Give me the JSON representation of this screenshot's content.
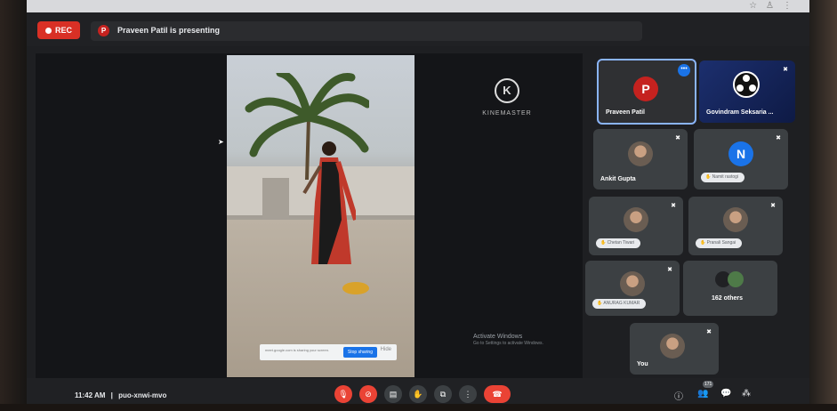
{
  "browser": {
    "icons": [
      "star-icon",
      "person-icon",
      "kebab-icon"
    ]
  },
  "header": {
    "rec_label": "REC",
    "presenter_initial": "P",
    "presenting_text": "Praveen Patil is presenting"
  },
  "stage": {
    "share_message": "meet.google.com is sharing your screen.",
    "stop_label": "Stop sharing",
    "hide_label": "Hide",
    "kinemaster_label": "KINEMASTER",
    "kinemaster_letter": "K",
    "activate_title": "Activate Windows",
    "activate_sub": "Go to Settings to activate Windows."
  },
  "participants": [
    {
      "name": "Praveen Patil",
      "initial": "P",
      "color": "#c5221f"
    },
    {
      "name": "Govindram Seksaria ..."
    },
    {
      "name": "Ankit Gupta"
    },
    {
      "name": "Namit rastogi",
      "initial": "N",
      "color": "#1a73e8"
    },
    {
      "name": "Chetan Tiwari"
    },
    {
      "name": "Pranali Sangai"
    },
    {
      "name": "ANURAG KUMAR"
    },
    {
      "name": "162 others"
    },
    {
      "name": "You"
    }
  ],
  "bottom": {
    "time": "11:42 AM",
    "separator": "|",
    "meeting_code": "puo-xnwi-mvo",
    "participant_count": "171"
  },
  "colors": {
    "accent": "#1a73e8",
    "danger": "#ea4335",
    "surface": "#202124",
    "tile": "#3c4043"
  }
}
